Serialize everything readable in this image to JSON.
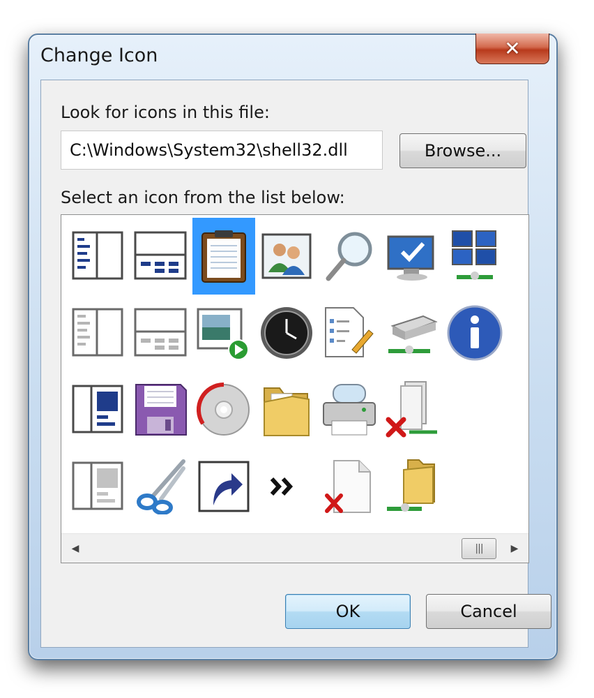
{
  "window": {
    "title": "Change Icon",
    "close_glyph": "✕"
  },
  "dialog": {
    "file_label": "Look for icons in this file:",
    "file_path": "C:\\Windows\\System32\\shell32.dll",
    "browse_label": "Browse...",
    "list_label": "Select an icon from the list below:",
    "ok_label": "OK",
    "cancel_label": "Cancel"
  },
  "icons": [
    [
      "panel-left-icon",
      "panel-bottom-icon",
      "clipboard-icon",
      "users-icon",
      "magnifier-icon",
      "computer-check-icon",
      "network-windows-icon"
    ],
    [
      "panel-left-gray-icon",
      "panel-bottom-gray-icon",
      "media-play-icon",
      "clock-icon",
      "document-edit-icon",
      "network-drive-icon",
      "info-icon"
    ],
    [
      "panel-right-blue-icon",
      "floppy-disk-icon",
      "cd-icon",
      "folder-open-icon",
      "printer-icon",
      "disconnected-drive-icon",
      ""
    ],
    [
      "panel-right-gray-icon",
      "scissors-icon",
      "shortcut-arrow-icon",
      "chevron-right-icon",
      "deleted-document-icon",
      "network-folder-icon",
      ""
    ]
  ],
  "selected_icon": "clipboard-icon",
  "scrollbar": {
    "left_arrow": "◀",
    "right_arrow": "▶",
    "thumb_grip": "|||"
  }
}
